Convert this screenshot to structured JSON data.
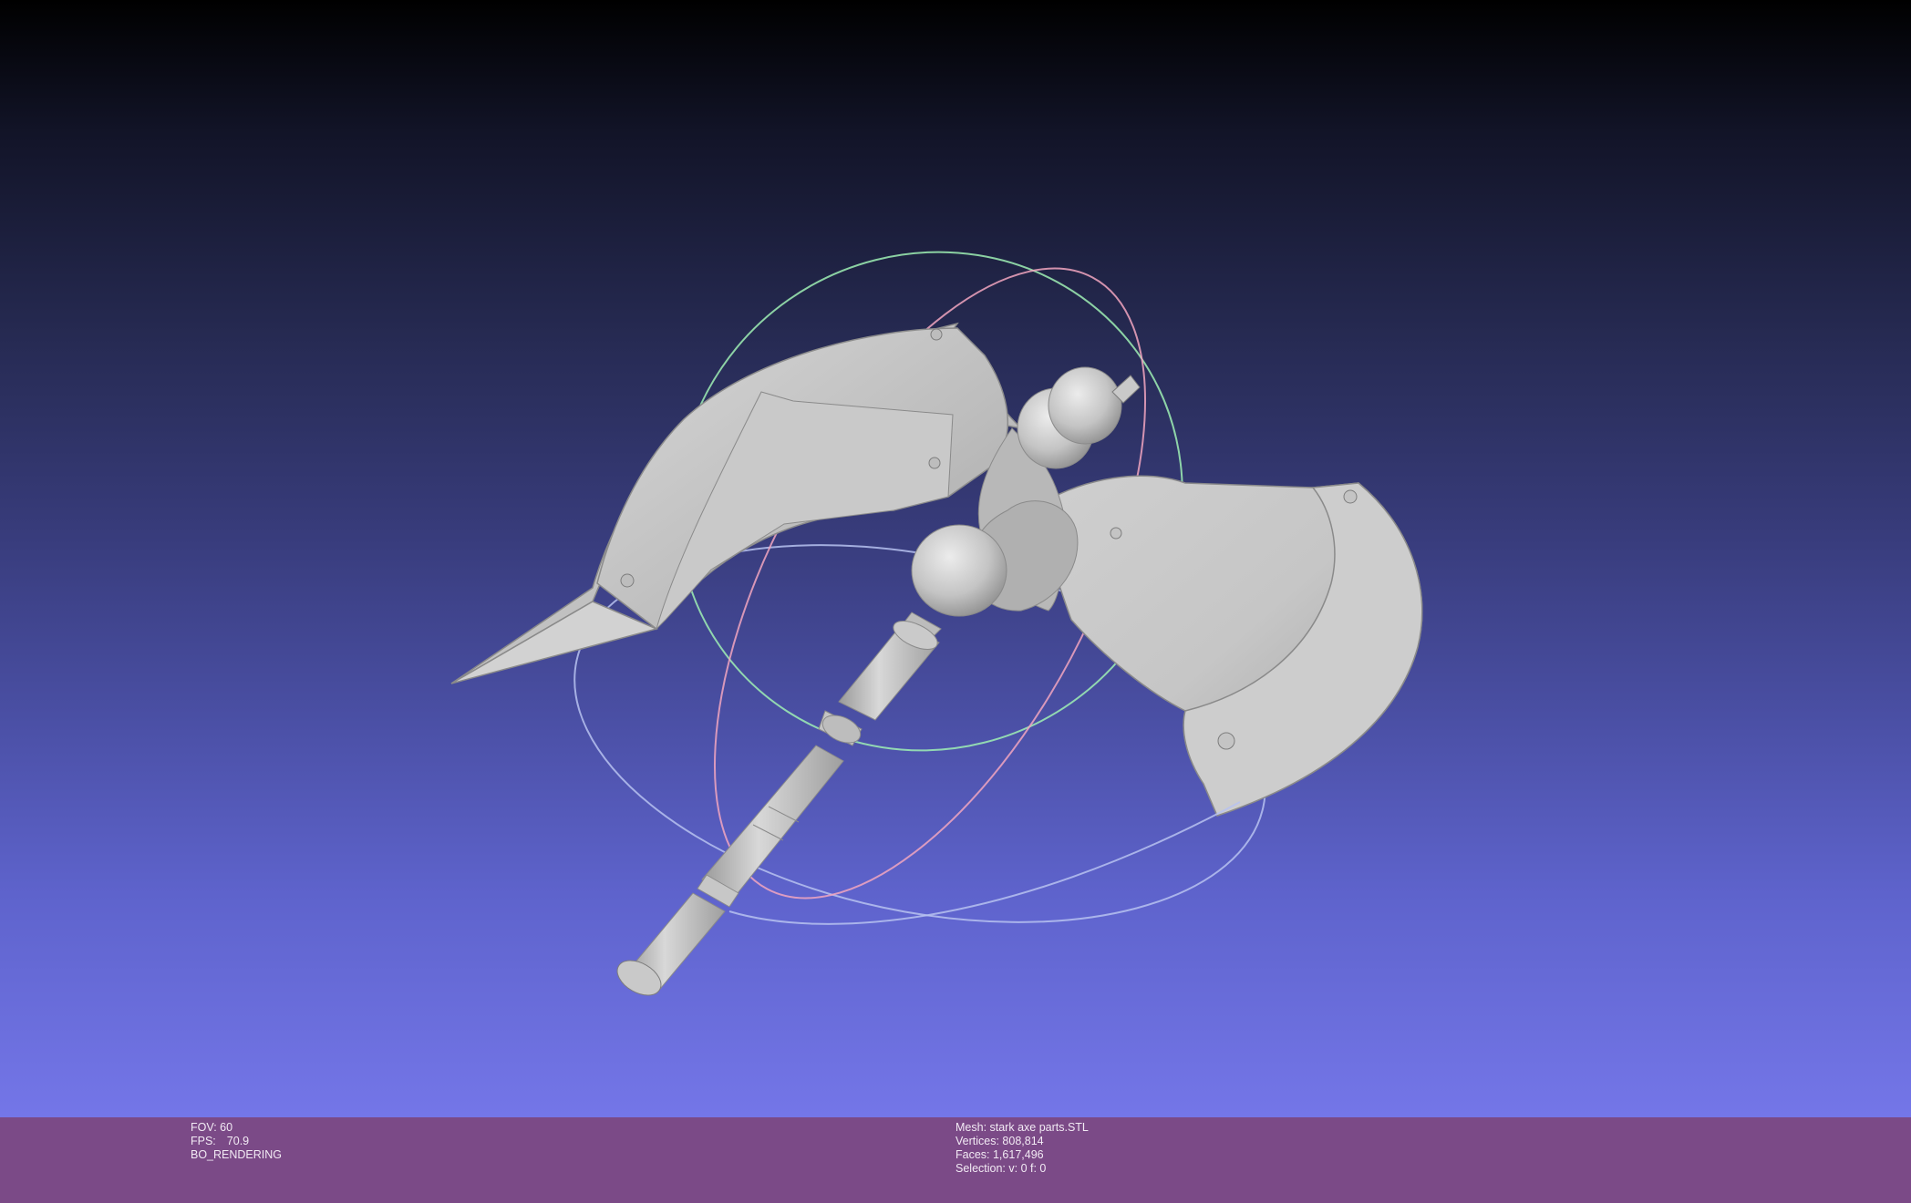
{
  "viewer": {
    "background_top": "#000000",
    "background_bottom": "#7476e8",
    "model_color": "#c8c8c8"
  },
  "info_left": {
    "fov": "FOV: 60",
    "fps_label": "FPS:",
    "fps_value": "70.9",
    "render_mode": "BO_RENDERING"
  },
  "info_right": {
    "mesh": "Mesh: stark axe parts.STL",
    "vertices": "Vertices: 808,814",
    "faces": "Faces: 1,617,496",
    "selection": "Selection: v: 0 f: 0"
  },
  "info_bar_color": "#7b4a87"
}
